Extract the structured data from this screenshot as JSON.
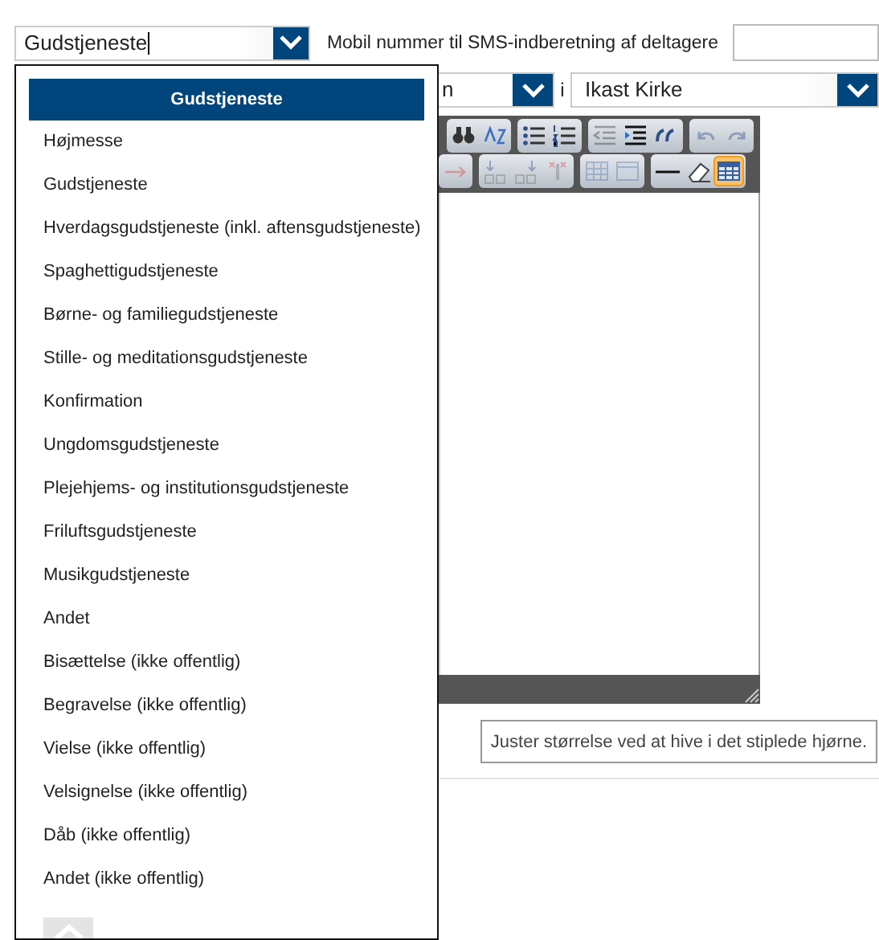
{
  "type_select": {
    "value": "Gudstjeneste"
  },
  "sms_label": "Mobil nummer til SMS-indberetning af deltagere",
  "place_row": {
    "select_1": {
      "value": "n"
    },
    "separator": "i",
    "select_2": {
      "value": "Ikast Kirke"
    }
  },
  "editor": {
    "toolbar_rows": [
      [
        [
          {
            "kind": "find",
            "disabled": false,
            "selected": false
          },
          {
            "kind": "replace",
            "disabled": false,
            "selected": false
          }
        ],
        [
          {
            "kind": "bullets",
            "disabled": false,
            "selected": false
          },
          {
            "kind": "numbers",
            "disabled": false,
            "selected": false
          }
        ],
        [
          {
            "kind": "outdent",
            "disabled": true,
            "selected": false
          },
          {
            "kind": "indent",
            "disabled": false,
            "selected": false
          },
          {
            "kind": "quote",
            "disabled": false,
            "selected": false
          }
        ],
        [
          {
            "kind": "undo",
            "disabled": true,
            "selected": false
          },
          {
            "kind": "redo",
            "disabled": true,
            "selected": false
          }
        ]
      ],
      [
        [
          {
            "kind": "arrow",
            "disabled": true,
            "selected": false
          }
        ],
        [
          {
            "kind": "col_before",
            "disabled": true,
            "selected": false
          },
          {
            "kind": "col_after",
            "disabled": true,
            "selected": false
          },
          {
            "kind": "col_delete",
            "disabled": true,
            "selected": false
          }
        ],
        [
          {
            "kind": "grid",
            "disabled": true,
            "selected": false
          },
          {
            "kind": "cells",
            "disabled": true,
            "selected": false
          }
        ],
        [
          {
            "kind": "hr",
            "disabled": false,
            "selected": false
          },
          {
            "kind": "eraser",
            "disabled": false,
            "selected": false
          },
          {
            "kind": "table",
            "disabled": false,
            "selected": true
          }
        ]
      ]
    ]
  },
  "resize_hint": "Juster størrelse ved at hive i det stiplede hjørne.",
  "dropdown": {
    "options": [
      {
        "label": "Gudstjeneste",
        "selected": true
      },
      {
        "label": "Højmesse",
        "selected": false
      },
      {
        "label": "Gudstjeneste",
        "selected": false
      },
      {
        "label": "Hverdagsgudstjeneste (inkl. aftensgudstjeneste)",
        "selected": false
      },
      {
        "label": "Spaghettigudstjeneste",
        "selected": false
      },
      {
        "label": "Børne- og familiegudstjeneste",
        "selected": false
      },
      {
        "label": "Stille- og meditationsgudstjeneste",
        "selected": false
      },
      {
        "label": "Konfirmation",
        "selected": false
      },
      {
        "label": "Ungdomsgudstjeneste",
        "selected": false
      },
      {
        "label": "Plejehjems- og institutionsgudstjeneste",
        "selected": false
      },
      {
        "label": "Friluftsgudstjeneste",
        "selected": false
      },
      {
        "label": "Musikgudstjeneste",
        "selected": false
      },
      {
        "label": "Andet",
        "selected": false
      },
      {
        "label": "Bisættelse (ikke offentlig)",
        "selected": false
      },
      {
        "label": "Begravelse (ikke offentlig)",
        "selected": false
      },
      {
        "label": "Vielse (ikke offentlig)",
        "selected": false
      },
      {
        "label": "Velsignelse (ikke offentlig)",
        "selected": false
      },
      {
        "label": "Dåb (ikke offentlig)",
        "selected": false
      },
      {
        "label": "Andet (ikke offentlig)",
        "selected": false
      }
    ]
  }
}
